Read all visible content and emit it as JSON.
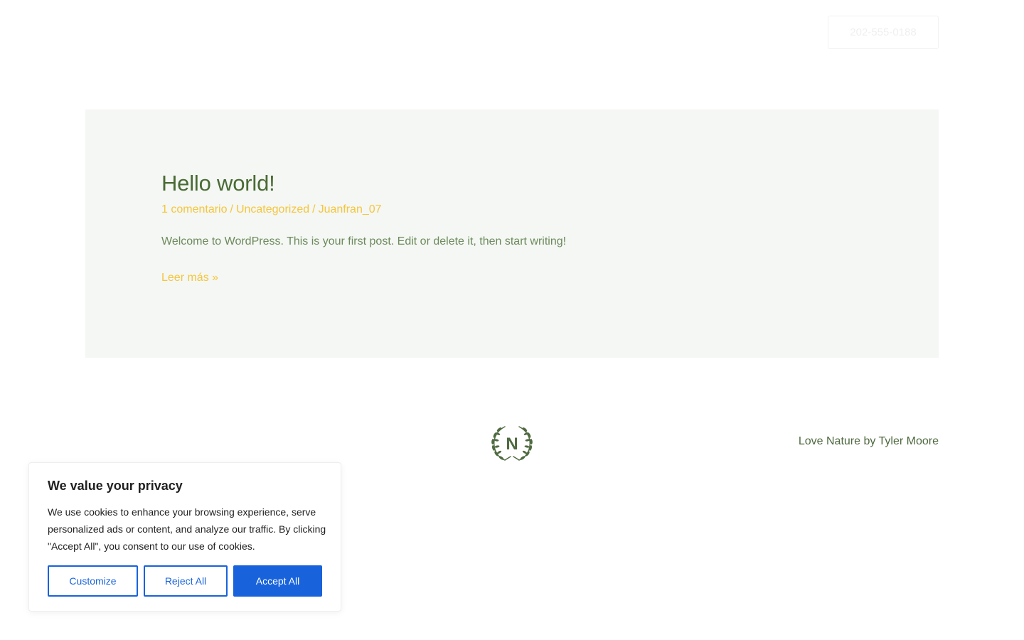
{
  "header": {
    "phone_label": "202-555-0188"
  },
  "post": {
    "title": "Hello world!",
    "meta": {
      "comments": "1 comentario",
      "category": "Uncategorized",
      "author": "Juanfran_07",
      "separator": "/"
    },
    "excerpt": "Welcome to WordPress. This is your first post. Edit or delete it, then start writing!",
    "read_more": "Leer más »"
  },
  "footer": {
    "logo_letter": "N",
    "credit": "Love Nature by Tyler Moore"
  },
  "cookie_banner": {
    "title": "We value your privacy",
    "text": "We use cookies to enhance your browsing experience, serve personalized ads or content, and analyze our traffic. By clicking \"Accept All\", you consent to our use of cookies.",
    "customize_label": "Customize",
    "reject_label": "Reject All",
    "accept_label": "Accept All"
  },
  "colors": {
    "post_title": "#4a6b34",
    "accent_yellow": "#f5c53c",
    "card_background": "#f4f7f3",
    "cookie_blue": "#1863dc"
  }
}
